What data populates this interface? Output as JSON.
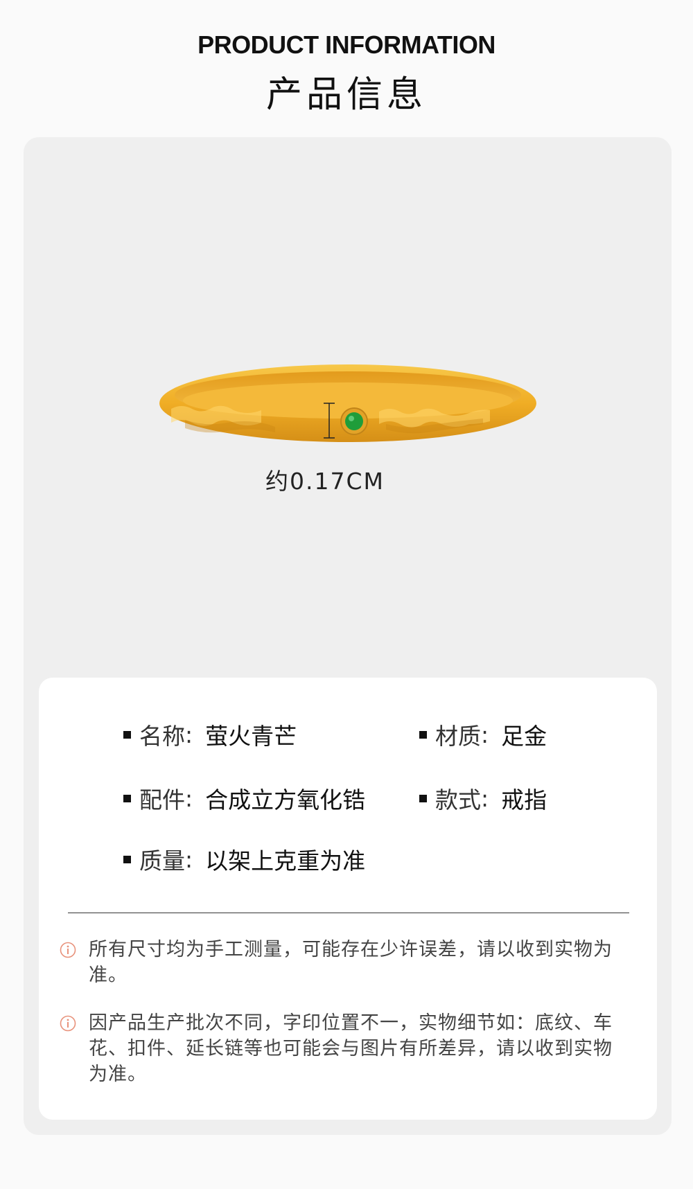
{
  "header": {
    "title_en": "PRODUCT INFORMATION",
    "title_cn": "产品信息"
  },
  "product_image": {
    "measure_label": "约0.17CM",
    "colors": {
      "gold": "#f2b32a",
      "gold_dark": "#d9951a",
      "gem": "#1f9d3a"
    }
  },
  "specs": [
    {
      "key": "名称",
      "sep": ":",
      "value": "萤火青芒"
    },
    {
      "key": "材质",
      "sep": ":",
      "value": "足金"
    },
    {
      "key": "配件",
      "sep": ":",
      "value": "合成立方氧化锆"
    },
    {
      "key": "款式",
      "sep": ":",
      "value": "戒指"
    },
    {
      "key": "质量",
      "sep": ":",
      "value": "以架上克重为准"
    }
  ],
  "notes": [
    {
      "icon": "info-icon",
      "text": "所有尺寸均为手工测量，可能存在少许误差，请以收到实物为准。"
    },
    {
      "icon": "info-icon",
      "text": "因产品生产批次不同，字印位置不一，实物细节如：底纹、车花、扣件、延长链等也可能会与图片有所差异，请以收到实物为准。"
    }
  ],
  "accent_color": "#e8917a"
}
